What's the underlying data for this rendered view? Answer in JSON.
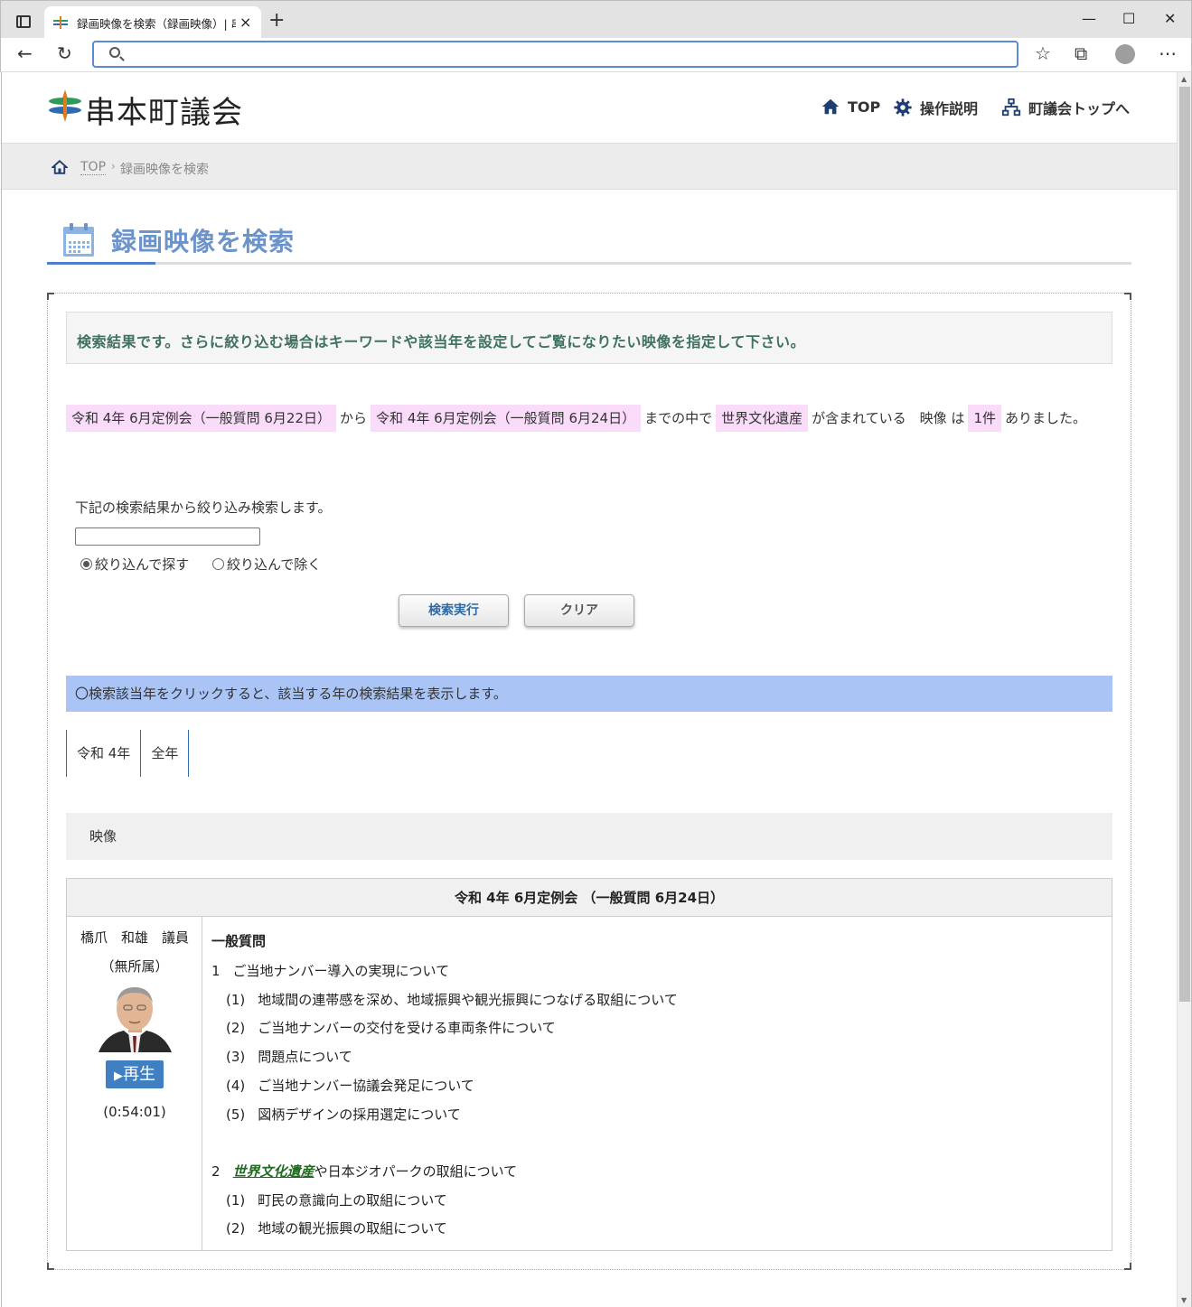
{
  "browser": {
    "tab_title": "録画映像を検索（録画映像）| 串",
    "tab_close": "×",
    "new_tab": "+",
    "minimize": "—",
    "maximize": "☐",
    "close": "✕",
    "back": "←",
    "reload": "↻",
    "favorites": "☆",
    "collections": "⧉",
    "more": "⋯"
  },
  "header": {
    "site_name": "串本町議会",
    "nav": [
      {
        "label": "TOP",
        "icon": "home-icon"
      },
      {
        "label": "操作説明",
        "icon": "gear-icon"
      },
      {
        "label": "町議会トップへ",
        "icon": "sitemap-icon"
      }
    ]
  },
  "breadcrumb": {
    "top": "TOP",
    "separator": "›",
    "current": "録画映像を検索"
  },
  "page_title": "録画映像を検索",
  "notice": "検索結果です。さらに絞り込む場合はキーワードや該当年を設定してご覧になりたい映像を指定して下さい。",
  "result": {
    "from": "令和 4年 6月定例会（一般質問 6月22日）",
    "from_suffix": "から",
    "to": "令和 4年 6月定例会（一般質問 6月24日）",
    "to_suffix": "までの中で",
    "keyword": "世界文化遺産",
    "keyword_suffix": "が含まれている　映像 は",
    "count": "1件",
    "count_suffix": "ありました。"
  },
  "refine": {
    "label": "下記の検索結果から絞り込み検索します。",
    "input_value": "",
    "radio_include": "絞り込んで探す",
    "radio_exclude": "絞り込んで除く",
    "search_button": "検索実行",
    "clear_button": "クリア"
  },
  "year_info": "〇検索該当年をクリックすると、該当する年の検索結果を表示します。",
  "year_tabs": [
    "令和 4年",
    "全年"
  ],
  "video_section": "映像",
  "video": {
    "session": "令和 4年 6月定例会 （一般質問 6月24日）",
    "member_name": "橋爪　和雄　議員",
    "member_party": "（無所属）",
    "play_label": "再生",
    "play_icon": "▶",
    "duration": "(0:54:01)",
    "question_title": "一般質問",
    "items": [
      {
        "num": "1",
        "text": "ご当地ナンバー導入の実現について"
      },
      {
        "num": "(1)",
        "text": "地域間の連帯感を深め、地域振興や観光振興につなげる取組について"
      },
      {
        "num": "(2)",
        "text": "ご当地ナンバーの交付を受ける車両条件について"
      },
      {
        "num": "(3)",
        "text": "問題点について"
      },
      {
        "num": "(4)",
        "text": "ご当地ナンバー協議会発足について"
      },
      {
        "num": "(5)",
        "text": "図柄デザインの採用選定について"
      },
      {
        "num": "2",
        "keyword": "世界文化遺産",
        "text": "や日本ジオパークの取組について"
      },
      {
        "num": "(1)",
        "text": "町民の意識向上の取組について"
      },
      {
        "num": "(2)",
        "text": "地域の観光振興の取組について"
      }
    ]
  },
  "colors": {
    "accent": "#6b93cc",
    "highlight": "#fadcfa",
    "year_bar": "#a9c4f5",
    "notice_text": "#3f7160",
    "keyword": "#1f6b1f"
  }
}
